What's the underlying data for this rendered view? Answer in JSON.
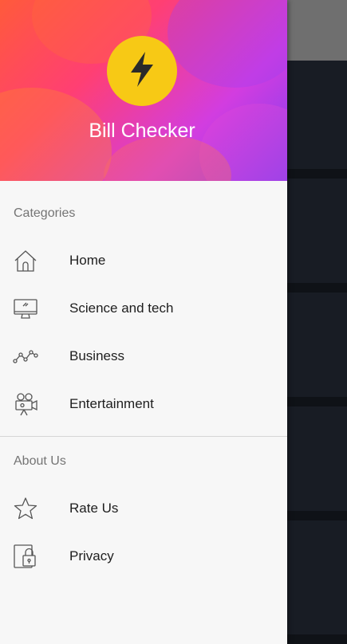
{
  "drawer": {
    "app_title": "Bill Checker",
    "header_gradient": [
      "#ff5a3b",
      "#ff3f73",
      "#d23de0",
      "#7d3ef0"
    ],
    "logo": {
      "icon": "lightning-bolt-icon",
      "color": "#f7c915"
    }
  },
  "categories": {
    "title": "Categories",
    "items": [
      {
        "label": "Home",
        "icon": "home-icon"
      },
      {
        "label": "Science and tech",
        "icon": "monitor-icon"
      },
      {
        "label": "Business",
        "icon": "line-chart-icon"
      },
      {
        "label": "Entertainment",
        "icon": "movie-camera-icon"
      }
    ]
  },
  "about": {
    "title": "About Us",
    "items": [
      {
        "label": "Rate Us",
        "icon": "star-icon"
      },
      {
        "label": "Privacy",
        "icon": "lock-document-icon"
      }
    ]
  },
  "colors": {
    "drawer_bg": "#f7f7f7",
    "section_label": "#747474",
    "item_label": "#1e1e1e",
    "scrim_topbar": "#6f6f6f",
    "content_bg": "#1b1f28"
  }
}
